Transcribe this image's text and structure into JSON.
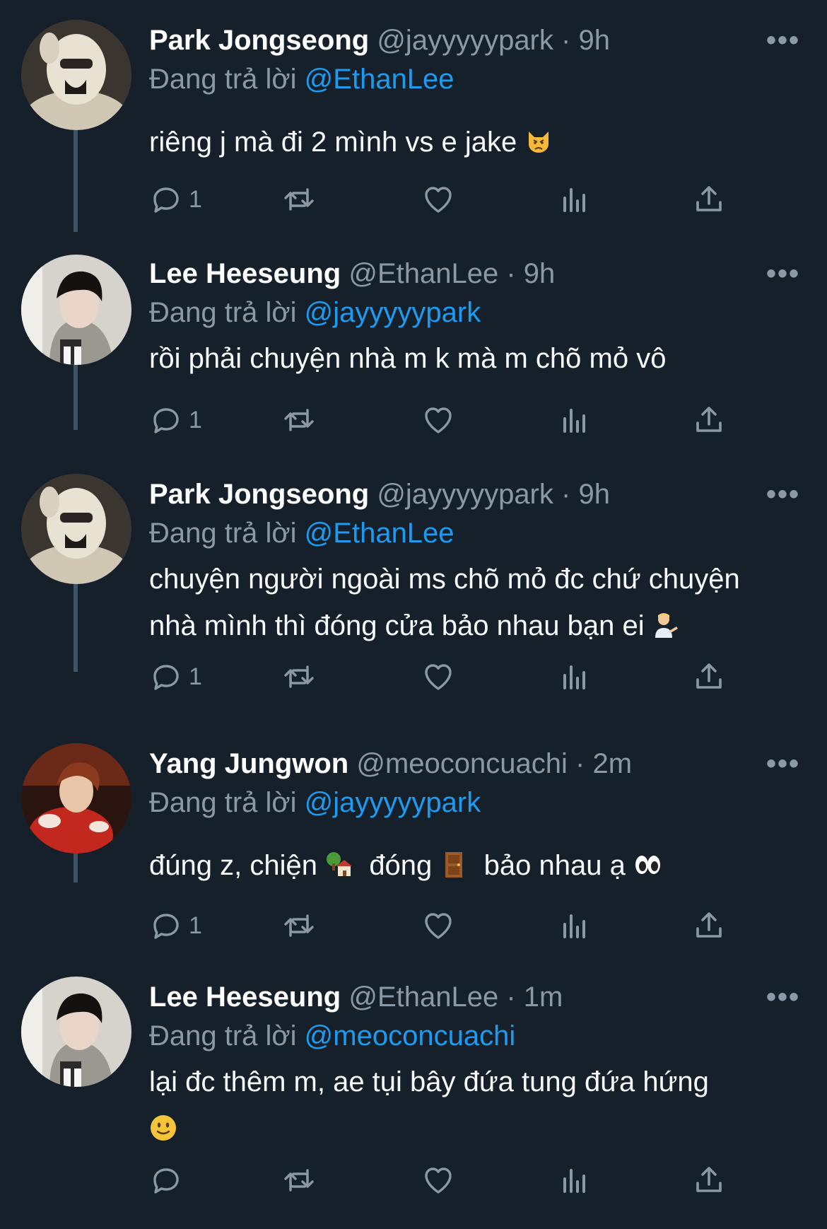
{
  "replying_label": "Đang trả lời",
  "more_label": "•••",
  "colors": {
    "background": "#15202b",
    "accent_blue": "#1d9bf0",
    "secondary_text": "#8b98a5",
    "thread_line": "#3d5466"
  },
  "tweets": [
    {
      "name": "Park Jongseong",
      "handle": "@jayyyyypark",
      "dot": "·",
      "time": "9h",
      "reply_to": "@EthanLee",
      "text": "riêng j mà đi 2 mình vs e jake",
      "emoji": "pouting-cat",
      "reply_count": "1",
      "avatar": "white-hood-avatar"
    },
    {
      "name": "Lee Heeseung",
      "handle": "@EthanLee",
      "dot": "·",
      "time": "9h",
      "reply_to": "@jayyyyypark",
      "text": "rồi phải chuyện nhà m k mà m chõ mỏ vô",
      "reply_count": "1",
      "avatar": "dark-hair-avatar"
    },
    {
      "name": "Park Jongseong",
      "handle": "@jayyyyypark",
      "dot": "·",
      "time": "9h",
      "reply_to": "@EthanLee",
      "text_line1": "chuyện người ngoài ms chõ mỏ đc chứ chuyện",
      "text_line2": "nhà mình thì đóng cửa bảo nhau bạn ei",
      "emoji": "person-tipping-hand",
      "reply_count": "1",
      "avatar": "white-hood-avatar"
    },
    {
      "name": "Yang Jungwon",
      "handle": "@meoconcuachi",
      "dot": "·",
      "time": "2m",
      "reply_to": "@jayyyyypark",
      "text_part1": "đúng z, chiện",
      "text_part2": "đóng",
      "text_part3": "bảo nhau ạ",
      "emojis": [
        "house-with-garden",
        "door",
        "eyes"
      ],
      "reply_count": "1",
      "avatar": "red-jacket-avatar"
    },
    {
      "name": "Lee Heeseung",
      "handle": "@EthanLee",
      "dot": "·",
      "time": "1m",
      "reply_to": "@meoconcuachi",
      "text": "lại đc thêm m, ae tụi bây đứa tung đứa hứng",
      "emoji": "slightly-smiling-face",
      "reply_count": "",
      "avatar": "dark-hair-avatar"
    }
  ]
}
